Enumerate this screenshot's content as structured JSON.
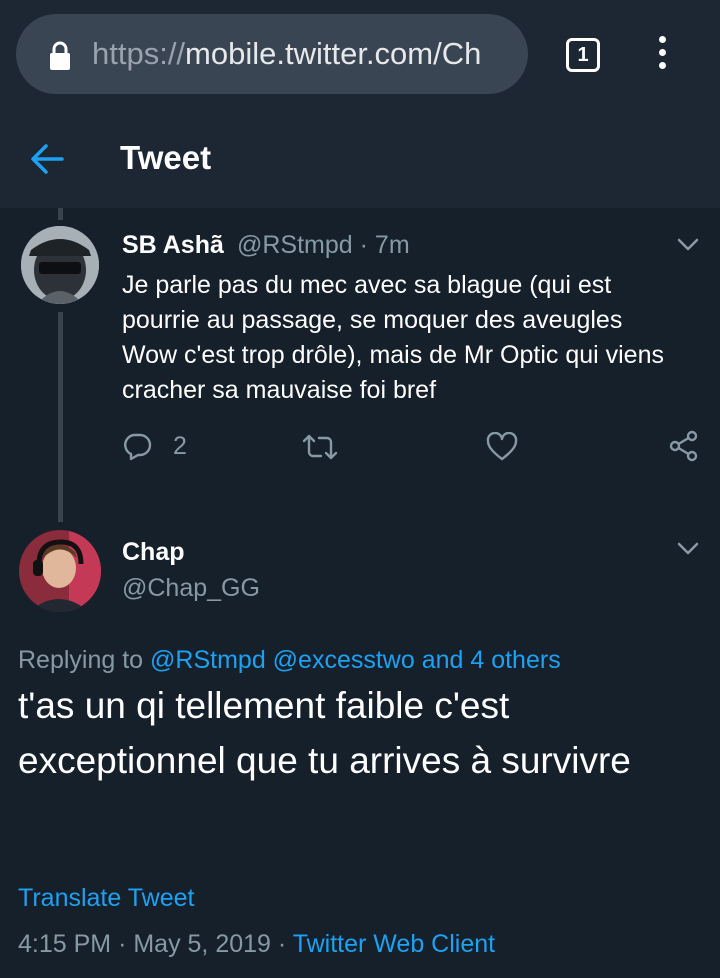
{
  "browser": {
    "url_scheme": "https://",
    "url_host": "mobile.twitter.com/Ch",
    "tab_count": "1"
  },
  "header": {
    "title": "Tweet"
  },
  "parent_tweet": {
    "name": "SB Ashã",
    "handle": "@RStmpd",
    "separator": "·",
    "time": "7m",
    "text": "Je parle pas du mec avec sa blague (qui est pourrie au passage, se moquer des aveugles Wow c'est trop drôle), mais de Mr Optic qui viens cracher sa mauvaise foi bref",
    "reply_count": "2"
  },
  "main_tweet": {
    "name": "Chap",
    "handle": "@Chap_GG",
    "replying_prefix": "Replying to",
    "replying_to": "@RStmpd @excesstwo and 4 others",
    "text": "t'as un qi tellement faible c'est exceptionnel que tu arrives à survivre",
    "translate_label": "Translate Tweet",
    "time": "4:15 PM",
    "date": "May 5, 2019",
    "dot": "·",
    "client": "Twitter Web Client"
  },
  "colors": {
    "background": "#15202b",
    "chrome": "#1c2733",
    "accent": "#1da1f2",
    "secondary_text": "#8899a6"
  },
  "icons": [
    "lock-icon",
    "tabs-icon",
    "more-vert-icon",
    "back-arrow-icon",
    "chevron-down-icon",
    "reply-icon",
    "retweet-icon",
    "like-icon",
    "share-icon"
  ]
}
